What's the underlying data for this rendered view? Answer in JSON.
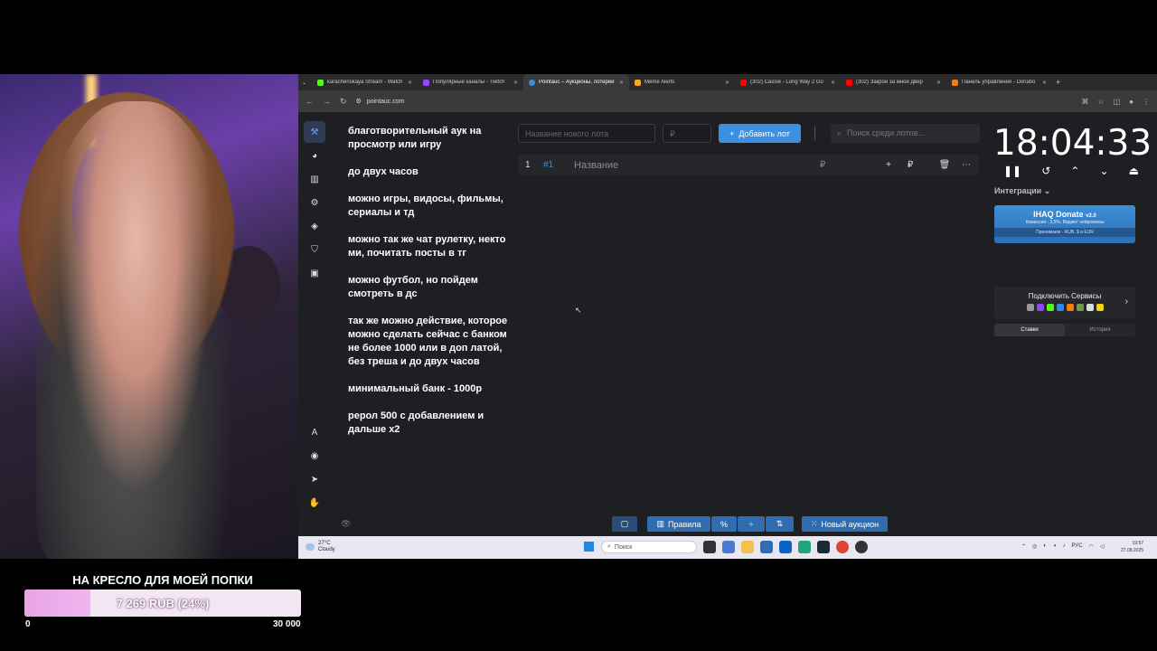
{
  "overlay": {
    "donation_goal_title": "НА КРЕСЛО ДЛЯ МОЕЙ ПОПКИ",
    "donation_progress_text": "7 269 RUB (24%)",
    "donation_progress_fraction": 0.24,
    "donation_min": "0",
    "donation_max": "30 000",
    "accent_color": "#f2b5ef"
  },
  "browser": {
    "tabs": [
      {
        "title": "karachenskaya Stream - Watch",
        "icon": "kick-icon",
        "color": "#53fc18",
        "active": false
      },
      {
        "title": "Популярные каналы - Twitch",
        "icon": "twitch-icon",
        "color": "#9146ff",
        "active": false
      },
      {
        "title": "Pointauc – Аукционы, лотереи",
        "icon": "pointauc-icon",
        "color": "#3d8fe0",
        "active": true
      },
      {
        "title": "Meme Alerts",
        "icon": "meme-alerts-icon",
        "color": "#f5a623",
        "active": false
      },
      {
        "title": "(302) Cassie - Long Way 2 Go",
        "icon": "youtube-icon",
        "color": "#ff0000",
        "active": false
      },
      {
        "title": "(302) Закрой за мной двер",
        "icon": "youtube-icon",
        "color": "#ff0000",
        "active": false
      },
      {
        "title": "Панель управления - Donatio",
        "icon": "donationalerts-icon",
        "color": "#f57d07",
        "active": false
      }
    ],
    "url": "pointauc.com"
  },
  "app": {
    "rules": [
      "благотворительный аук на просмотр или игру",
      "до  двух часов",
      "можно игры, видосы, фильмы, сериалы и тд",
      "можно так же чат рулетку, некто ми, почитать посты в тг",
      "можно футбол, но пойдем смотреть в дс",
      "так же можно действие, которое можно сделать сейчас с банком не более 1000 или в доп латой, без треша  и до двух часов",
      "минимальный банк - 1000р",
      "рерол 500 с добавлением и дальше х2"
    ],
    "new_lot_placeholder": "Название нового лота",
    "price_placeholder": "₽",
    "add_lot_label": "Добавить лот",
    "search_placeholder": "Поиск среди лотов...",
    "lots": [
      {
        "num": "1",
        "id": "#1",
        "name": "Название",
        "currency": "₽"
      }
    ],
    "timer": "18:04:33",
    "integrations_label": "Интеграции",
    "donate_card": {
      "title": "IHAQ Donate",
      "version": "v2.0",
      "subtitle": "Комиссия - 3,5%, Виджет нейромемы",
      "footer": "Принимаем - RUB, $ и EUR"
    },
    "services_label": "Подключить Сервисы",
    "bottom_tabs": [
      "Ставки",
      "История"
    ],
    "toolbar": {
      "rules_label": "Правила",
      "percent_label": "%",
      "new_auction_label": "Новый аукцион"
    }
  },
  "taskbar": {
    "temperature": "27°C",
    "weather": "Cloudy",
    "search_label": "Поиск",
    "lang": "РУС",
    "time": "19:57",
    "date": "27.08.2025"
  }
}
